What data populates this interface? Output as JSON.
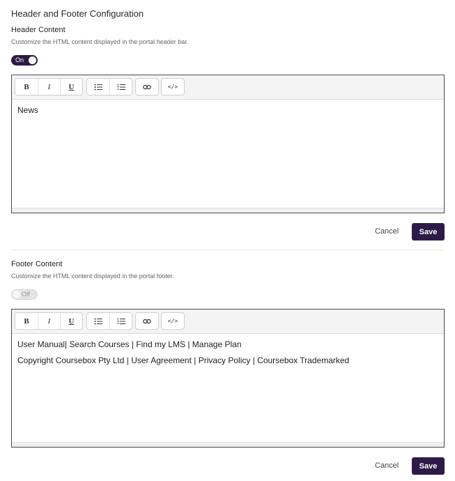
{
  "page": {
    "title": "Header and Footer Configuration"
  },
  "toolbar": {
    "bold": "B",
    "italic": "I",
    "underline": "U",
    "bullet_list_icon": "bullet-list-icon",
    "numbered_list_icon": "numbered-list-icon",
    "link_icon": "link-icon",
    "code": "</>"
  },
  "header": {
    "title": "Header Content",
    "description": "Customize the HTML content displayed in the portal header bar.",
    "toggle": "On",
    "content": [
      "News"
    ],
    "cancel": "Cancel",
    "save": "Save"
  },
  "footer": {
    "title": "Footer Content",
    "description": "Customize the HTML content displayed in the portal footer.",
    "toggle": "Off",
    "content": [
      "User Manual| Search Courses | Find my LMS | Manage Plan",
      "Copyright Coursebox Pty Ltd | User Agreement | Privacy Policy | Coursebox Trademarked"
    ],
    "cancel": "Cancel",
    "save": "Save"
  },
  "colors": {
    "accent": "#2e1a47",
    "border": "#4a4a4a"
  }
}
